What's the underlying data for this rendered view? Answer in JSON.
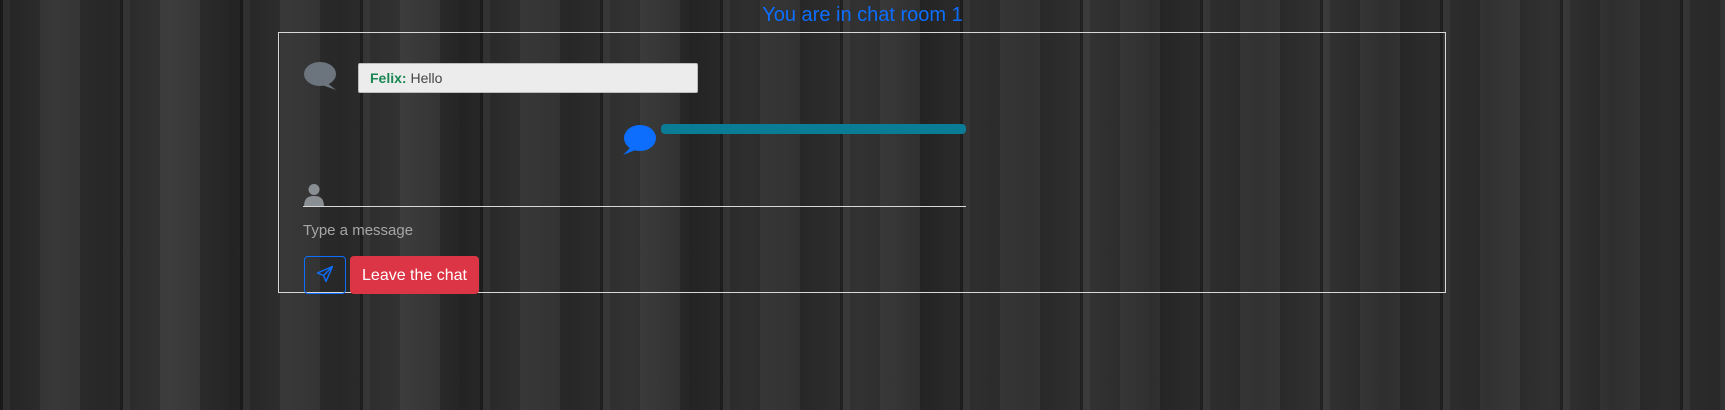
{
  "header": {
    "title": "You are in chat room 1"
  },
  "messages": [
    {
      "sender": "Felix:",
      "text": "Hello"
    }
  ],
  "composer": {
    "placeholder": "Type a message",
    "leave_label": "Leave the chat"
  },
  "icons": {
    "received_message": "chat-bubble-icon",
    "typing_indicator": "chat-bubble-icon",
    "user": "person-icon",
    "send": "send-icon"
  },
  "colors": {
    "title": "#0d6efd",
    "sender": "#198754",
    "typing_bar": "#0b7c96",
    "leave_button": "#dc3545",
    "send_button_border": "#0d6efd"
  }
}
